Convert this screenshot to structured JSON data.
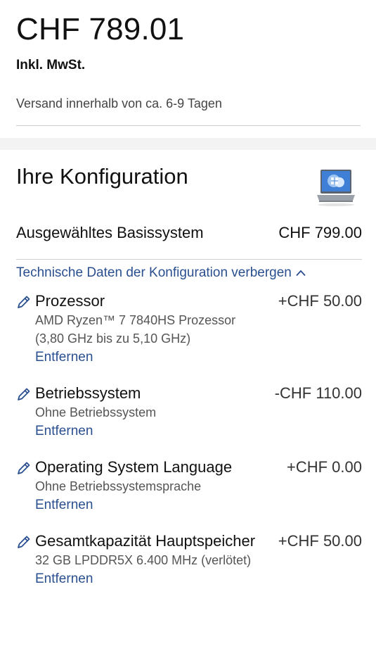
{
  "price": {
    "main": "CHF 789.01",
    "vat": "Inkl. MwSt.",
    "shipping": "Versand innerhalb von ca. 6-9 Tagen"
  },
  "config": {
    "title": "Ihre Konfiguration",
    "base_label": "Ausgewähltes Basissystem",
    "base_price": "CHF 799.00",
    "toggle_label": "Technische Daten der Konfiguration verbergen",
    "items": [
      {
        "name": "Prozessor",
        "price": "+CHF 50.00",
        "desc": "AMD Ryzen™ 7 7840HS Prozessor (3,80 GHz bis zu 5,10 GHz)",
        "remove": "Entfernen"
      },
      {
        "name": "Betriebssystem",
        "price": "-CHF 110.00",
        "desc": "Ohne Betriebssystem",
        "remove": "Entfernen"
      },
      {
        "name": "Operating System Language",
        "price": "+CHF 0.00",
        "desc": "Ohne Betriebssystemsprache",
        "remove": "Entfernen"
      },
      {
        "name": "Gesamtkapazität Hauptspeicher",
        "price": "+CHF 50.00",
        "desc": "32 GB LPDDR5X 6.400 MHz (verlötet)",
        "remove": "Entfernen"
      }
    ]
  },
  "colors": {
    "link": "#2a4f8f",
    "text": "#111111",
    "muted": "#555555",
    "band": "#f3f3f3"
  },
  "icons": {
    "edit": "pencil-icon",
    "toggle": "chevron-up-icon",
    "product": "laptop-image"
  }
}
